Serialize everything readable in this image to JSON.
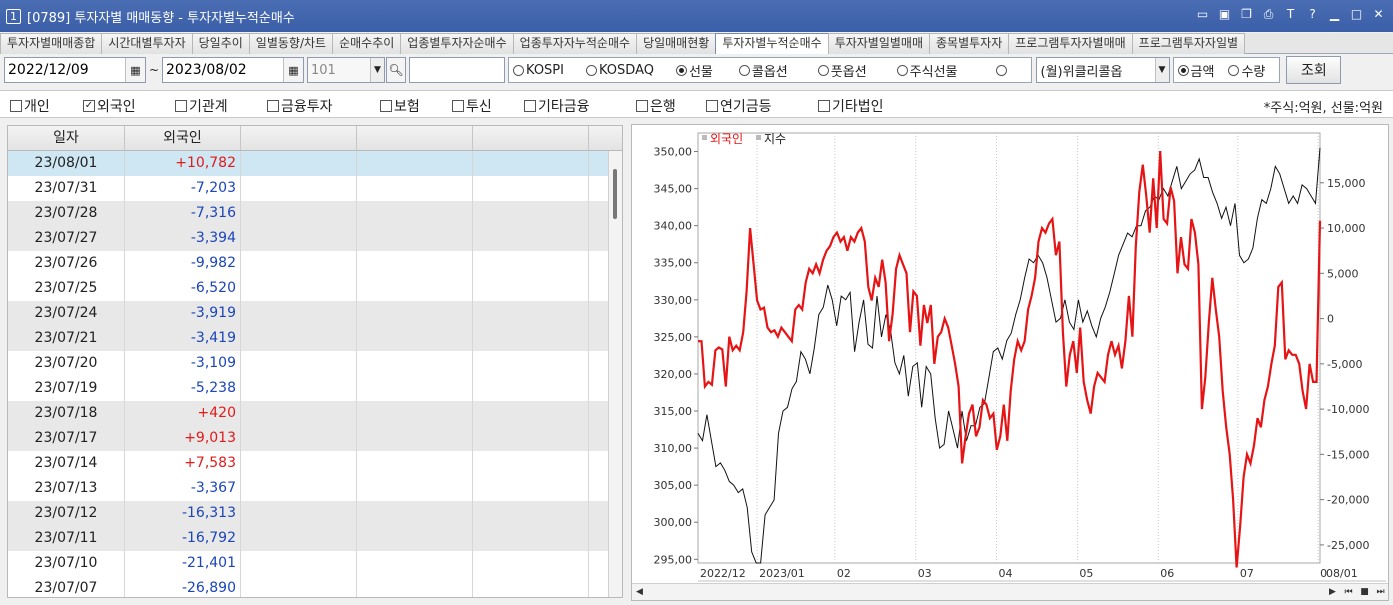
{
  "window": {
    "number": "1",
    "title": "[0789] 투자자별 매매동향 - 투자자별누적순매수"
  },
  "tabs": [
    {
      "label": "투자자별매매종합",
      "active": false
    },
    {
      "label": "시간대별투자자",
      "active": false
    },
    {
      "label": "당일추이",
      "active": false
    },
    {
      "label": "일별동향/차트",
      "active": false
    },
    {
      "label": "순매수추이",
      "active": false
    },
    {
      "label": "업종별투자자순매수",
      "active": false
    },
    {
      "label": "업종투자자누적순매수",
      "active": false
    },
    {
      "label": "당일매매현황",
      "active": false
    },
    {
      "label": "투자자별누적순매수",
      "active": true
    },
    {
      "label": "투자자별일별매매",
      "active": false
    },
    {
      "label": "종목별투자자",
      "active": false
    },
    {
      "label": "프로그램투자자별매매",
      "active": false
    },
    {
      "label": "프로그램투자자일별",
      "active": false
    }
  ],
  "toolbar": {
    "start_date": "2022/12/09",
    "tilde": "~",
    "end_date": "2023/08/02",
    "code": "101",
    "name": "",
    "market_options": [
      {
        "label": "KOSPI",
        "selected": false
      },
      {
        "label": "KOSDAQ",
        "selected": false
      },
      {
        "label": "선물",
        "selected": true
      },
      {
        "label": "콜옵션",
        "selected": false
      },
      {
        "label": "풋옵션",
        "selected": false
      },
      {
        "label": "주식선물",
        "selected": false
      },
      {
        "label": "",
        "selected": false
      }
    ],
    "weekly_select": "(월)위클리콜옵",
    "unit_options": [
      {
        "label": "금액",
        "selected": true
      },
      {
        "label": "수량",
        "selected": false
      }
    ],
    "query_label": "조회"
  },
  "investor_checks": [
    {
      "label": "개인",
      "checked": false
    },
    {
      "label": "외국인",
      "checked": true
    },
    {
      "label": "기관계",
      "checked": false
    },
    {
      "label": "금융투자",
      "checked": false
    },
    {
      "label": "보험",
      "checked": false
    },
    {
      "label": "투신",
      "checked": false
    },
    {
      "label": "기타금융",
      "checked": false
    },
    {
      "label": "은행",
      "checked": false
    },
    {
      "label": "연기금등",
      "checked": false
    },
    {
      "label": "기타법인",
      "checked": false
    }
  ],
  "unit_note": "*주식:억원, 선물:억원",
  "table": {
    "headers": [
      "일자",
      "외국인",
      "",
      "",
      "",
      ""
    ],
    "rows": [
      {
        "date": "23/08/01",
        "value": "+10,782",
        "sign": "pos"
      },
      {
        "date": "23/07/31",
        "value": "-7,203",
        "sign": "neg"
      },
      {
        "date": "23/07/28",
        "value": "-7,316",
        "sign": "neg"
      },
      {
        "date": "23/07/27",
        "value": "-3,394",
        "sign": "neg"
      },
      {
        "date": "23/07/26",
        "value": "-9,982",
        "sign": "neg"
      },
      {
        "date": "23/07/25",
        "value": "-6,520",
        "sign": "neg"
      },
      {
        "date": "23/07/24",
        "value": "-3,919",
        "sign": "neg"
      },
      {
        "date": "23/07/21",
        "value": "-3,419",
        "sign": "neg"
      },
      {
        "date": "23/07/20",
        "value": "-3,109",
        "sign": "neg"
      },
      {
        "date": "23/07/19",
        "value": "-5,238",
        "sign": "neg"
      },
      {
        "date": "23/07/18",
        "value": "+420",
        "sign": "pos"
      },
      {
        "date": "23/07/17",
        "value": "+9,013",
        "sign": "pos"
      },
      {
        "date": "23/07/14",
        "value": "+7,583",
        "sign": "pos"
      },
      {
        "date": "23/07/13",
        "value": "-3,367",
        "sign": "neg"
      },
      {
        "date": "23/07/12",
        "value": "-16,313",
        "sign": "neg"
      },
      {
        "date": "23/07/11",
        "value": "-16,792",
        "sign": "neg"
      },
      {
        "date": "23/07/10",
        "value": "-21,401",
        "sign": "neg"
      },
      {
        "date": "23/07/07",
        "value": "-26,890",
        "sign": "neg"
      }
    ]
  },
  "chart_data": {
    "type": "line",
    "legend": [
      "외국인",
      "지수"
    ],
    "legend_position": "top-left",
    "left_axis": {
      "ticks": [
        "350,00",
        "345,00",
        "340,00",
        "335,00",
        "330,00",
        "325,00",
        "320,00",
        "315,00",
        "310,00",
        "305,00",
        "300,00",
        "295,00"
      ],
      "range": [
        294.5,
        352.5
      ]
    },
    "right_axis": {
      "ticks": [
        "15,000",
        "10,000",
        "5,000",
        "0",
        "-5,000",
        "-10,000",
        "-15,000",
        "-20,000",
        "-25,000"
      ],
      "range": [
        -27000,
        20500
      ]
    },
    "x_ticks": [
      "2022/12",
      "2023/01",
      "02",
      "03",
      "04",
      "05",
      "06",
      "07",
      "0",
      "08/01"
    ],
    "colors": {
      "foreign": "#e61414",
      "index": "#111111",
      "grid": "#c8c8c8"
    },
    "series": [
      {
        "name": "외국인",
        "axis": "right",
        "values": [
          -2500,
          -2500,
          -7500,
          -7000,
          -7300,
          -3500,
          -3200,
          -3400,
          -7500,
          -2000,
          -3500,
          -3000,
          -3500,
          -1500,
          3000,
          10000,
          6000,
          2000,
          1000,
          1200,
          -1000,
          -1500,
          -1300,
          -2000,
          -1000,
          -1500,
          -2000,
          -2500,
          1000,
          1500,
          1000,
          4000,
          5500,
          5000,
          6000,
          5000,
          6500,
          7500,
          8000,
          9000,
          9500,
          8500,
          9000,
          7500,
          9000,
          8500,
          9500,
          10000,
          8500,
          3500,
          2000,
          4500,
          3500,
          6500,
          4000,
          -2500,
          500,
          5500,
          7000,
          6000,
          5000,
          -1500,
          3000,
          2500,
          -3000,
          1500,
          -500,
          1500,
          -5000,
          -2000,
          -1500,
          0,
          -1000,
          -3000,
          -5000,
          -7500,
          -16000,
          -13000,
          -10500,
          -9500,
          -13000,
          -12000,
          -9000,
          -9500,
          -11000,
          -10500,
          -14500,
          -13000,
          -9500,
          -13500,
          -8000,
          -4500,
          -2500,
          -3500,
          -2500,
          1000,
          2500,
          4500,
          8500,
          10000,
          9500,
          10500,
          11000,
          7000,
          8500,
          -1500,
          -7500,
          -4000,
          -2500,
          -6000,
          -1000,
          -7000,
          -9000,
          -10500,
          -7500,
          -6000,
          -6500,
          -7000,
          -4000,
          -2500,
          -4000,
          -3000,
          -5500,
          -2500,
          2500,
          -2000,
          8000,
          14000,
          17000,
          13500,
          9500,
          15500,
          10000,
          18500,
          11000,
          10500,
          14500,
          13000,
          5000,
          9000,
          6000,
          5500,
          11000,
          9500,
          6000,
          -10000,
          -6500,
          -500,
          4500,
          1000,
          -2000,
          -8000,
          -12000,
          -15000,
          -20000,
          -27500,
          -23000,
          -17500,
          -15000,
          -16000,
          -14000,
          -11000,
          -12000,
          -9000,
          -7500,
          -5000,
          -3000,
          3500,
          4000,
          -4500,
          -3500,
          -4000,
          -4000,
          -5000,
          -8000,
          -10000,
          -5000,
          -7000,
          -7000,
          10800
        ]
      },
      {
        "name": "지수",
        "axis": "left",
        "values": [
          312,
          311,
          314.5,
          311,
          307.5,
          308,
          307,
          305.5,
          305,
          304,
          304.5,
          302,
          296,
          294.5,
          294.5,
          301,
          302,
          303,
          312,
          315,
          315.5,
          318,
          319,
          323,
          322,
          320,
          323.5,
          328,
          329,
          332,
          330,
          326.5,
          330.5,
          330,
          331,
          323,
          327,
          330,
          324,
          323.5,
          330.5,
          325,
          328,
          326,
          321.5,
          320,
          322.5,
          317,
          321,
          321.5,
          315.5,
          321,
          320,
          314,
          310,
          310.5,
          315,
          312.5,
          310,
          315,
          311,
          313,
          313,
          315.5,
          316,
          319.5,
          323,
          323.5,
          322,
          324.5,
          325.5,
          328,
          330,
          333,
          335.5,
          335,
          336,
          335,
          333,
          330,
          327,
          327.5,
          330,
          327,
          326,
          330,
          327,
          328.5,
          326.5,
          325,
          327.5,
          329,
          331,
          333.5,
          336,
          337.5,
          339,
          338.5,
          340,
          340,
          342,
          342.5,
          344,
          343.5,
          345,
          344,
          346,
          348,
          345,
          346,
          347,
          347.5,
          349,
          346.5,
          346.5,
          344.5,
          343,
          341,
          342.5,
          340,
          343,
          336,
          335,
          335.5,
          337,
          341,
          343.5,
          343,
          345,
          348,
          347,
          345,
          343,
          344,
          343,
          345.5,
          345,
          344,
          343,
          350.5
        ]
      }
    ]
  },
  "scroll_icons": {
    "left": "scroll-left-icon",
    "right": "scroll-right-icon"
  }
}
